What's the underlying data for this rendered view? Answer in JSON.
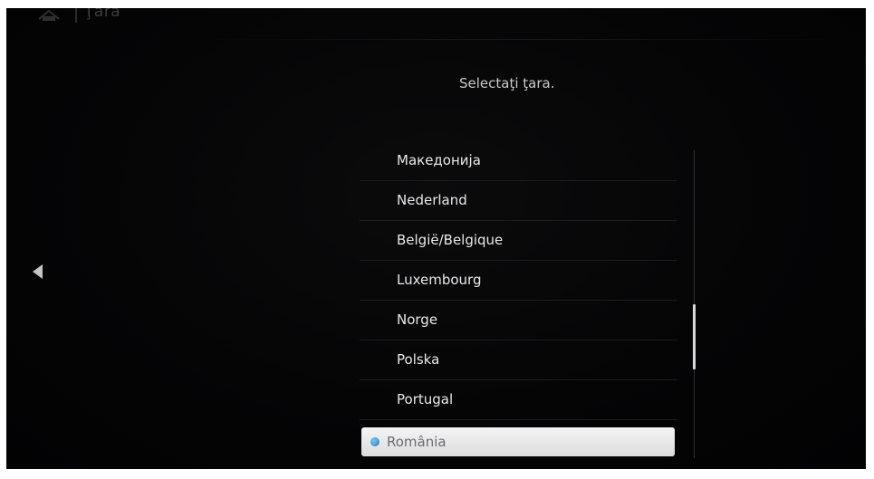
{
  "header": {
    "title": "Ţara",
    "icon": "home-icon"
  },
  "prompt": "Selectaţi ţara.",
  "nav": {
    "back_icon": "back-arrow-icon"
  },
  "countries": {
    "items": [
      {
        "label": "Македонија"
      },
      {
        "label": "Nederland"
      },
      {
        "label": "België/Belgique"
      },
      {
        "label": "Luxembourg"
      },
      {
        "label": "Norge"
      },
      {
        "label": "Polska"
      },
      {
        "label": "Portugal"
      }
    ],
    "selected": {
      "label": "România"
    }
  },
  "colors": {
    "background": "#050506",
    "text": "#e9e9ea",
    "selection": "#f0f0f1",
    "radio_accent": "#2a8fd4"
  }
}
